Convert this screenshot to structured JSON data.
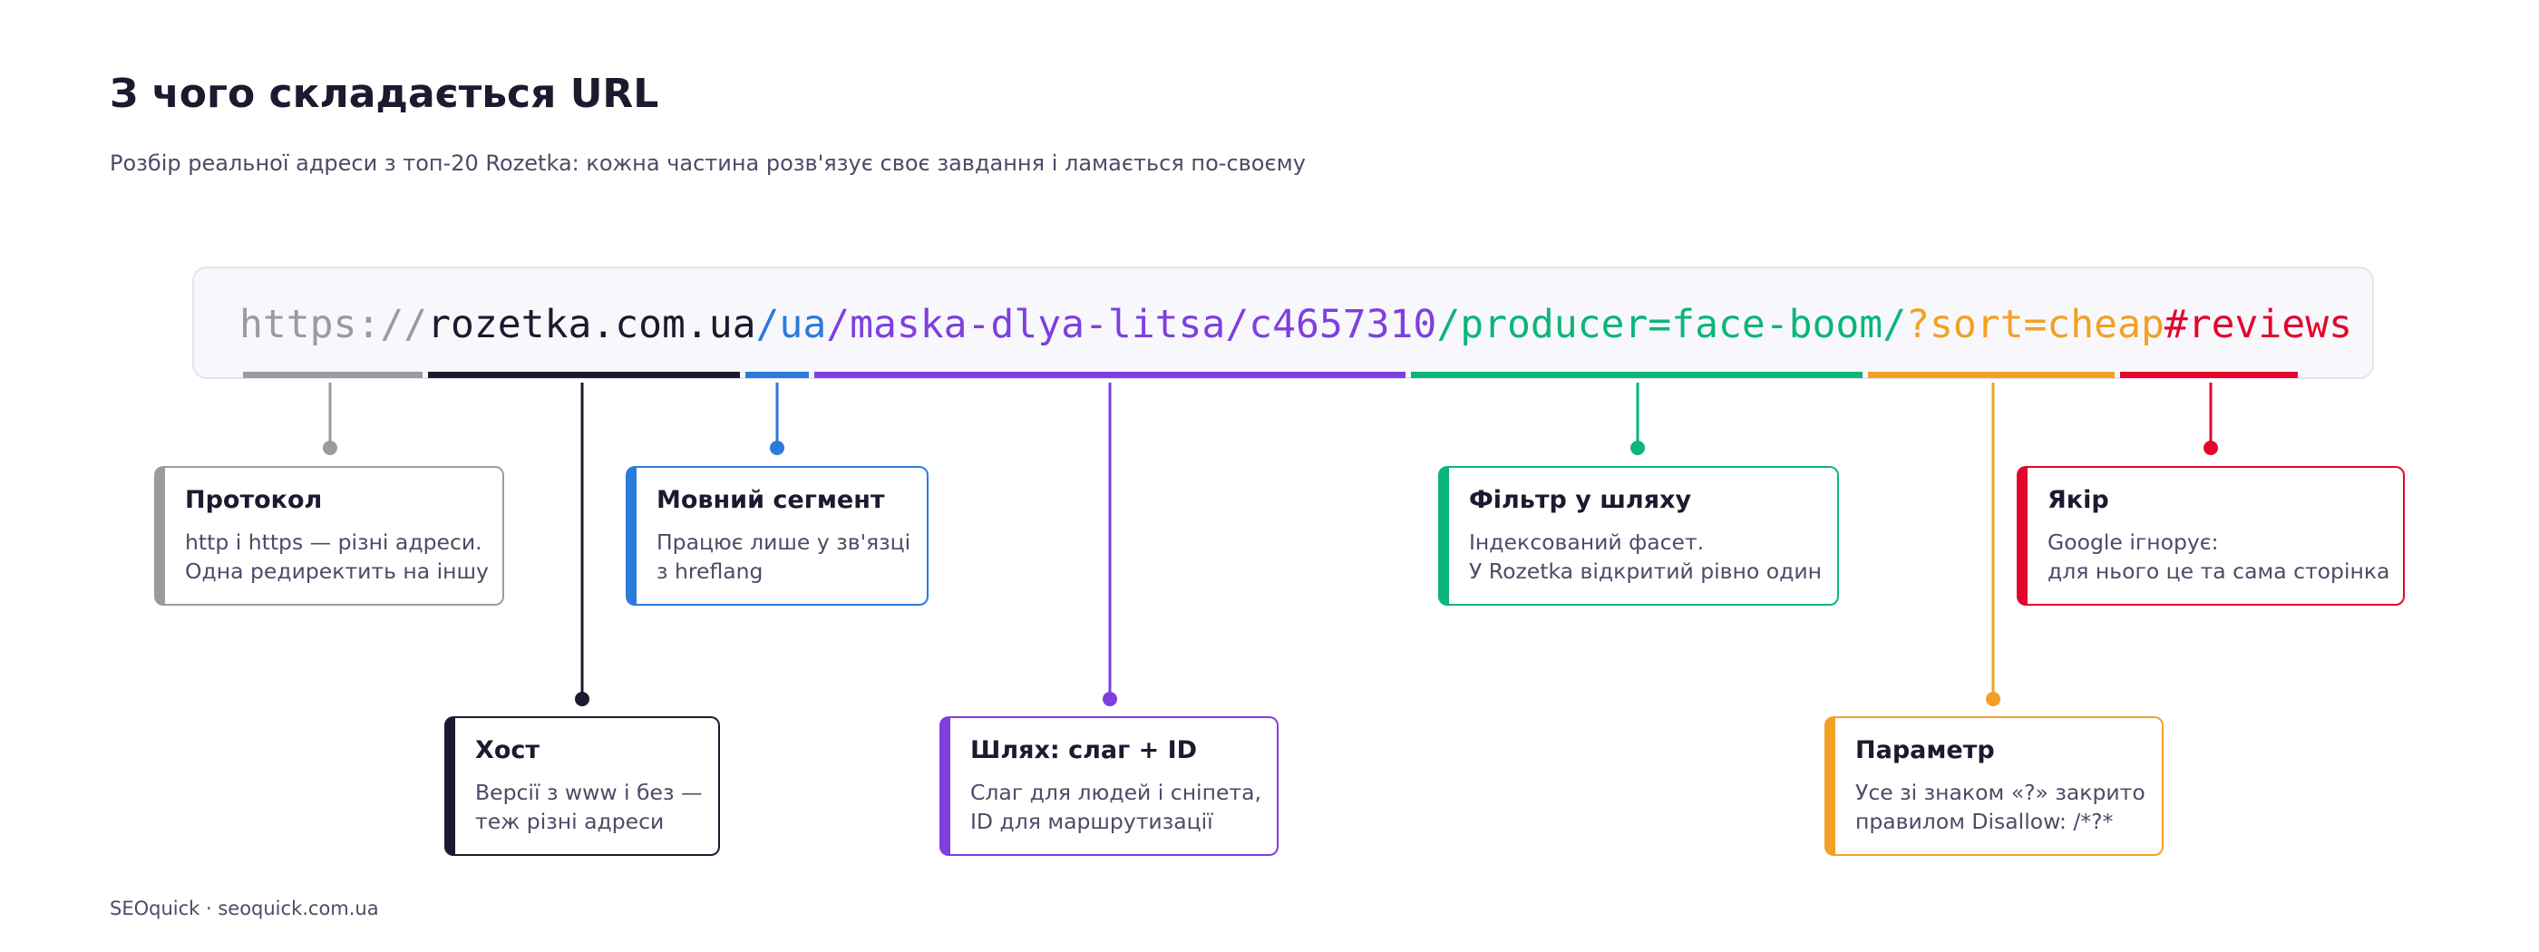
{
  "title": "З чого складається URL",
  "subtitle": "Розбір реальної адреси з топ-20 Rozetka: кожна частина розв'язує своє завдання і ламається по-своєму",
  "url_segments": [
    {
      "id": "protocol",
      "text": "https://",
      "color": "#9a9ba1"
    },
    {
      "id": "host",
      "text": "rozetka.com.ua",
      "color": "#1b1a2e"
    },
    {
      "id": "lang",
      "text": "/ua",
      "color": "#2b7bdb"
    },
    {
      "id": "path",
      "text": "/maska-dlya-litsa/c4657310",
      "color": "#7f3fe0"
    },
    {
      "id": "filter",
      "text": "/producer=face-boom/",
      "color": "#0bb57b"
    },
    {
      "id": "param",
      "text": "?sort=cheap",
      "color": "#f2a124"
    },
    {
      "id": "anchor",
      "text": "#reviews",
      "color": "#e4052d"
    }
  ],
  "cards": [
    {
      "id": "protocol",
      "title": "Протокол",
      "line1": "http і https — різні адреси.",
      "line2": "Одна редиректить на іншу",
      "color": "#9a9ba1"
    },
    {
      "id": "host",
      "title": "Хост",
      "line1": "Версії з www і без —",
      "line2": "теж різні адреси",
      "color": "#1b1a2e"
    },
    {
      "id": "lang",
      "title": "Мовний сегмент",
      "line1": "Працює лише у зв'язці",
      "line2": "з hreflang",
      "color": "#2b7bdb"
    },
    {
      "id": "path",
      "title": "Шлях: слаг + ID",
      "line1": "Слаг для людей і сніпета,",
      "line2": "ID для маршрутизації",
      "color": "#7f3fe0"
    },
    {
      "id": "filter",
      "title": "Фільтр у шляху",
      "line1": "Індексований фасет.",
      "line2": "У Rozetka відкритий рівно один",
      "color": "#0bb57b"
    },
    {
      "id": "param",
      "title": "Параметр",
      "line1": "Усе зі знаком «?» закрито",
      "line2": "правилом Disallow: /*?*",
      "color": "#f2a124"
    },
    {
      "id": "anchor",
      "title": "Якір",
      "line1": "Google ігнорує:",
      "line2": "для нього це та сама сторінка",
      "color": "#e4052d"
    }
  ],
  "footer": "SEOquick · seoquick.com.ua"
}
